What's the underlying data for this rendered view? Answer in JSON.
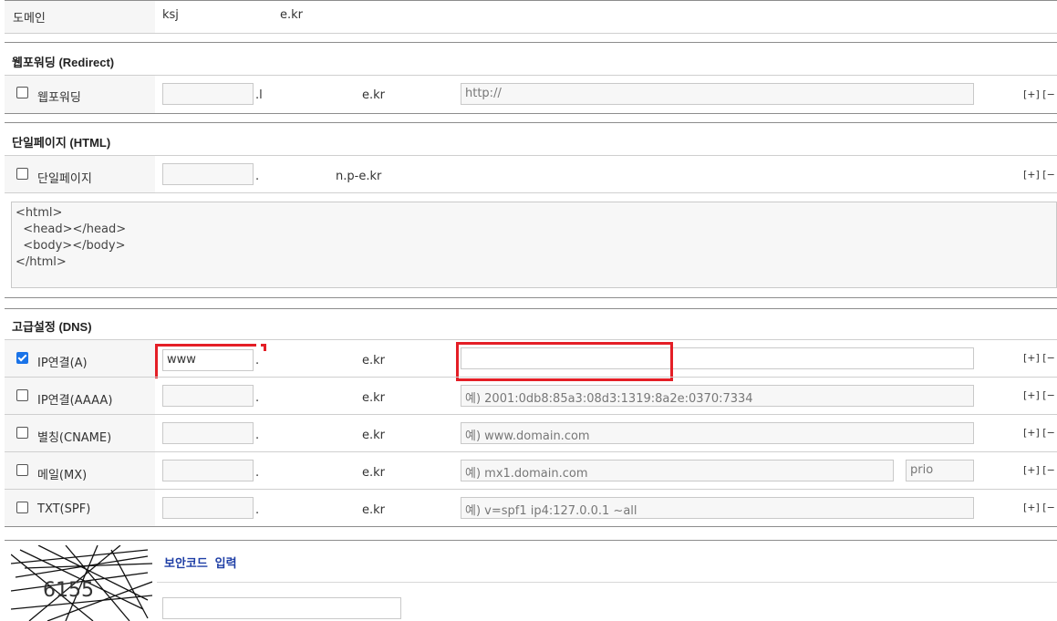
{
  "domain_row": {
    "label": "도메인",
    "value_prefix": "ksj",
    "value_suffix": "e.kr"
  },
  "sections": {
    "redirect": {
      "title": "웹포워딩 (Redirect)",
      "row": {
        "label": "웹포워딩",
        "host_value": "",
        "suffix_left": ".l",
        "suffix_right": "e.kr",
        "target_placeholder": "http://",
        "controls": "[+] [−"
      }
    },
    "html": {
      "title": "단일페이지 (HTML)",
      "row": {
        "label": "단일페이지",
        "host_value": "",
        "suffix_left": ".",
        "suffix_right": "n.p-e.kr",
        "controls": "[+] [−"
      },
      "textarea": "<html>\n  <head></head>\n  <body></body>\n</html>"
    },
    "dns": {
      "title": "고급설정 (DNS)",
      "rows": [
        {
          "label": "IP연결(A)",
          "checked": true,
          "host_value": "www",
          "suffix_left": ".",
          "suffix_right": "e.kr",
          "target_value": "",
          "target_placeholder": "",
          "controls": "[+] [−"
        },
        {
          "label": "IP연결(AAAA)",
          "checked": false,
          "host_value": "",
          "suffix_left": ".",
          "suffix_right": "e.kr",
          "target_value": "",
          "target_placeholder": "예) 2001:0db8:85a3:08d3:1319:8a2e:0370:7334",
          "controls": "[+] [−"
        },
        {
          "label": "별칭(CNAME)",
          "checked": false,
          "host_value": "",
          "suffix_left": ".",
          "suffix_right": "e.kr",
          "target_value": "",
          "target_placeholder": "예) www.domain.com",
          "controls": "[+] [−"
        },
        {
          "label": "메일(MX)",
          "checked": false,
          "host_value": "",
          "suffix_left": ".",
          "suffix_right": "e.kr",
          "target_value": "",
          "target_placeholder": "예) mx1.domain.com",
          "prio_placeholder": "prio",
          "controls": "[+] [−"
        },
        {
          "label": "TXT(SPF)",
          "checked": false,
          "host_value": "",
          "suffix_left": ".",
          "suffix_right": "e.kr",
          "target_value": "",
          "target_placeholder": "예) v=spf1 ip4:127.0.0.1 ~all",
          "controls": "[+] [−"
        }
      ]
    }
  },
  "captcha": {
    "code_text": "6155",
    "label": "보안코드 입력",
    "input_value": ""
  },
  "colors": {
    "highlight": "#e41e26",
    "checkbox_checked": "#1a73e8",
    "captcha_label": "#1f3fa6"
  }
}
